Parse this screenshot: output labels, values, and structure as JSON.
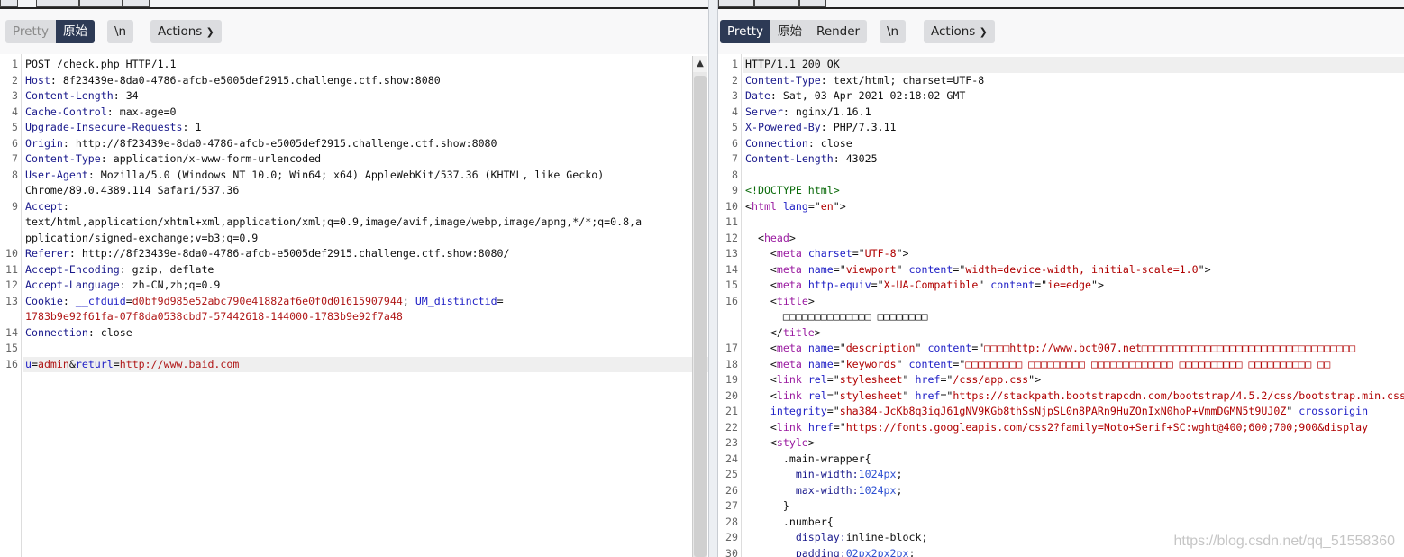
{
  "request": {
    "view_tabs": [
      "Pretty",
      "原始"
    ],
    "active_tab": "原始",
    "newline_label": "\\n",
    "actions_label": "Actions",
    "lines": [
      {
        "n": "1",
        "segs": [
          [
            "POST /check.php HTTP/1.1",
            "v"
          ]
        ]
      },
      {
        "n": "2",
        "segs": [
          [
            "Host",
            "k"
          ],
          [
            ": 8f23439e-8da0-4786-afcb-e5005def2915.challenge.ctf.show:8080",
            "v"
          ]
        ]
      },
      {
        "n": "3",
        "segs": [
          [
            "Content-Length",
            "k"
          ],
          [
            ": 34",
            "v"
          ]
        ]
      },
      {
        "n": "4",
        "segs": [
          [
            "Cache-Control",
            "k"
          ],
          [
            ": max-age=0",
            "v"
          ]
        ]
      },
      {
        "n": "5",
        "segs": [
          [
            "Upgrade-Insecure-Requests",
            "k"
          ],
          [
            ": 1",
            "v"
          ]
        ]
      },
      {
        "n": "6",
        "segs": [
          [
            "Origin",
            "k"
          ],
          [
            ": http://8f23439e-8da0-4786-afcb-e5005def2915.challenge.ctf.show:8080",
            "v"
          ]
        ]
      },
      {
        "n": "7",
        "segs": [
          [
            "Content-Type",
            "k"
          ],
          [
            ": application/x-www-form-urlencoded",
            "v"
          ]
        ]
      },
      {
        "n": "8",
        "segs": [
          [
            "User-Agent",
            "k"
          ],
          [
            ": Mozilla/5.0 (Windows NT 10.0; Win64; x64) AppleWebKit/537.36 (KHTML, like Gecko)",
            "v"
          ]
        ]
      },
      {
        "n": "",
        "segs": [
          [
            "Chrome/89.0.4389.114 Safari/537.36",
            "v"
          ]
        ]
      },
      {
        "n": "9",
        "segs": [
          [
            "Accept",
            "k"
          ],
          [
            ":",
            "v"
          ]
        ]
      },
      {
        "n": "",
        "segs": [
          [
            "text/html,application/xhtml+xml,application/xml;q=0.9,image/avif,image/webp,image/apng,*/*;q=0.8,a",
            "v"
          ]
        ]
      },
      {
        "n": "",
        "segs": [
          [
            "pplication/signed-exchange;v=b3;q=0.9",
            "v"
          ]
        ]
      },
      {
        "n": "10",
        "segs": [
          [
            "Referer",
            "k"
          ],
          [
            ": http://8f23439e-8da0-4786-afcb-e5005def2915.challenge.ctf.show:8080/",
            "v"
          ]
        ]
      },
      {
        "n": "11",
        "segs": [
          [
            "Accept-Encoding",
            "k"
          ],
          [
            ": gzip, deflate",
            "v"
          ]
        ]
      },
      {
        "n": "12",
        "segs": [
          [
            "Accept-Language",
            "k"
          ],
          [
            ": zh-CN,zh;q=0.9",
            "v"
          ]
        ]
      },
      {
        "n": "13",
        "segs": [
          [
            "Cookie",
            "k"
          ],
          [
            ": ",
            "v"
          ],
          [
            "__cfduid",
            "at"
          ],
          [
            "=",
            "v"
          ],
          [
            "d0bf9d985e52abc790e41882af6e0f0d01615907944",
            "r"
          ],
          [
            "; ",
            "v"
          ],
          [
            "UM_distinctid",
            "at"
          ],
          [
            "=",
            "v"
          ]
        ]
      },
      {
        "n": "",
        "segs": [
          [
            "1783b9e92f61fa-07f8da0538cbd7-57442618-144000-1783b9e92f7a48",
            "r"
          ]
        ]
      },
      {
        "n": "14",
        "segs": [
          [
            "Connection",
            "k"
          ],
          [
            ": close",
            "v"
          ]
        ]
      },
      {
        "n": "15",
        "segs": []
      },
      {
        "n": "16",
        "hl": true,
        "segs": [
          [
            "u",
            "at"
          ],
          [
            "=",
            "v"
          ],
          [
            "admin",
            "r"
          ],
          [
            "&",
            "v"
          ],
          [
            "returl",
            "at"
          ],
          [
            "=",
            "v"
          ],
          [
            "http://www.baid.com",
            "r"
          ]
        ]
      }
    ]
  },
  "response": {
    "view_tabs": [
      "Pretty",
      "原始",
      "Render"
    ],
    "active_tab": "Pretty",
    "newline_label": "\\n",
    "actions_label": "Actions",
    "lines": [
      {
        "n": "1",
        "hl": true,
        "segs": [
          [
            "HTTP/1.1 200 OK",
            "v"
          ]
        ]
      },
      {
        "n": "2",
        "segs": [
          [
            "Content-Type",
            "k"
          ],
          [
            ": text/html; charset=UTF-8",
            "v"
          ]
        ]
      },
      {
        "n": "3",
        "segs": [
          [
            "Date",
            "k"
          ],
          [
            ": Sat, 03 Apr 2021 02:18:02 GMT",
            "v"
          ]
        ]
      },
      {
        "n": "4",
        "segs": [
          [
            "Server",
            "k"
          ],
          [
            ": nginx/1.16.1",
            "v"
          ]
        ]
      },
      {
        "n": "5",
        "segs": [
          [
            "X-Powered-By",
            "k"
          ],
          [
            ": PHP/7.3.11",
            "v"
          ]
        ]
      },
      {
        "n": "6",
        "segs": [
          [
            "Connection",
            "k"
          ],
          [
            ": close",
            "v"
          ]
        ]
      },
      {
        "n": "7",
        "segs": [
          [
            "Content-Length",
            "k"
          ],
          [
            ": 43025",
            "v"
          ]
        ]
      },
      {
        "n": "8",
        "segs": []
      },
      {
        "n": "9",
        "segs": [
          [
            "<!DOCTYPE html>",
            "dt"
          ]
        ]
      },
      {
        "n": "10",
        "segs": [
          [
            "<",
            "p"
          ],
          [
            "html",
            "tag"
          ],
          [
            " ",
            "p"
          ],
          [
            "lang",
            "at"
          ],
          [
            "=\"",
            "p"
          ],
          [
            "en",
            "av"
          ],
          [
            "\">",
            "p"
          ]
        ]
      },
      {
        "n": "11",
        "segs": []
      },
      {
        "n": "12",
        "segs": [
          [
            "  <",
            "p"
          ],
          [
            "head",
            "tag"
          ],
          [
            ">",
            "p"
          ]
        ]
      },
      {
        "n": "13",
        "segs": [
          [
            "    <",
            "p"
          ],
          [
            "meta",
            "tag"
          ],
          [
            " ",
            "p"
          ],
          [
            "charset",
            "at"
          ],
          [
            "=\"",
            "p"
          ],
          [
            "UTF-8",
            "av"
          ],
          [
            "\">",
            "p"
          ]
        ]
      },
      {
        "n": "14",
        "segs": [
          [
            "    <",
            "p"
          ],
          [
            "meta",
            "tag"
          ],
          [
            " ",
            "p"
          ],
          [
            "name",
            "at"
          ],
          [
            "=\"",
            "p"
          ],
          [
            "viewport",
            "av"
          ],
          [
            "\" ",
            "p"
          ],
          [
            "content",
            "at"
          ],
          [
            "=\"",
            "p"
          ],
          [
            "width=device-width, initial-scale=1.0",
            "av"
          ],
          [
            "\">",
            "p"
          ]
        ]
      },
      {
        "n": "15",
        "segs": [
          [
            "    <",
            "p"
          ],
          [
            "meta",
            "tag"
          ],
          [
            " ",
            "p"
          ],
          [
            "http-equiv",
            "at"
          ],
          [
            "=\"",
            "p"
          ],
          [
            "X-UA-Compatible",
            "av"
          ],
          [
            "\" ",
            "p"
          ],
          [
            "content",
            "at"
          ],
          [
            "=\"",
            "p"
          ],
          [
            "ie=edge",
            "av"
          ],
          [
            "\">",
            "p"
          ]
        ]
      },
      {
        "n": "16",
        "segs": [
          [
            "    <",
            "p"
          ],
          [
            "title",
            "tag"
          ],
          [
            ">",
            "p"
          ]
        ]
      },
      {
        "n": "",
        "segs": [
          [
            "      □□□□□□□□□□□□□□ □□□□□□□□",
            "p"
          ]
        ]
      },
      {
        "n": "",
        "segs": [
          [
            "    </",
            "p"
          ],
          [
            "title",
            "tag"
          ],
          [
            ">",
            "p"
          ]
        ]
      },
      {
        "n": "17",
        "segs": [
          [
            "    <",
            "p"
          ],
          [
            "meta",
            "tag"
          ],
          [
            " ",
            "p"
          ],
          [
            "name",
            "at"
          ],
          [
            "=\"",
            "p"
          ],
          [
            "description",
            "av"
          ],
          [
            "\" ",
            "p"
          ],
          [
            "content",
            "at"
          ],
          [
            "=\"",
            "p"
          ],
          [
            "□□□□http://www.bct007.net□□□□□□□□□□□□□□□□□□□□□□□□□□□□□□□□□□",
            "av"
          ]
        ]
      },
      {
        "n": "18",
        "segs": [
          [
            "    <",
            "p"
          ],
          [
            "meta",
            "tag"
          ],
          [
            " ",
            "p"
          ],
          [
            "name",
            "at"
          ],
          [
            "=\"",
            "p"
          ],
          [
            "keywords",
            "av"
          ],
          [
            "\" ",
            "p"
          ],
          [
            "content",
            "at"
          ],
          [
            "=\"",
            "p"
          ],
          [
            "□□□□□□□□□ □□□□□□□□□ □□□□□□□□□□□□□ □□□□□□□□□□ □□□□□□□□□□ □□",
            "av"
          ]
        ]
      },
      {
        "n": "19",
        "segs": [
          [
            "    <",
            "p"
          ],
          [
            "link",
            "tag"
          ],
          [
            " ",
            "p"
          ],
          [
            "rel",
            "at"
          ],
          [
            "=\"",
            "p"
          ],
          [
            "stylesheet",
            "av"
          ],
          [
            "\" ",
            "p"
          ],
          [
            "href",
            "at"
          ],
          [
            "=\"",
            "p"
          ],
          [
            "/css/app.css",
            "av"
          ],
          [
            "\">",
            "p"
          ]
        ]
      },
      {
        "n": "20",
        "segs": [
          [
            "    <",
            "p"
          ],
          [
            "link",
            "tag"
          ],
          [
            " ",
            "p"
          ],
          [
            "rel",
            "at"
          ],
          [
            "=\"",
            "p"
          ],
          [
            "stylesheet",
            "av"
          ],
          [
            "\" ",
            "p"
          ],
          [
            "href",
            "at"
          ],
          [
            "=\"",
            "p"
          ],
          [
            "https://stackpath.bootstrapcdn.com/bootstrap/4.5.2/css/bootstrap.min.css",
            "av"
          ]
        ]
      },
      {
        "n": "21",
        "segs": [
          [
            "    ",
            "p"
          ],
          [
            "integrity",
            "at"
          ],
          [
            "=\"",
            "p"
          ],
          [
            "sha384-JcKb8q3iqJ61gNV9KGb8thSsNjpSL0n8PARn9HuZOnIxN0hoP+VmmDGMN5t9UJ0Z",
            "av"
          ],
          [
            "\" ",
            "p"
          ],
          [
            "crossorigin",
            "at"
          ]
        ]
      },
      {
        "n": "22",
        "segs": [
          [
            "    <",
            "p"
          ],
          [
            "link",
            "tag"
          ],
          [
            " ",
            "p"
          ],
          [
            "href",
            "at"
          ],
          [
            "=\"",
            "p"
          ],
          [
            "https://fonts.googleapis.com/css2?family=Noto+Serif+SC:wght@400;600;700;900&display",
            "av"
          ]
        ]
      },
      {
        "n": "23",
        "segs": [
          [
            "    <",
            "p"
          ],
          [
            "style",
            "tag"
          ],
          [
            ">",
            "p"
          ]
        ]
      },
      {
        "n": "24",
        "segs": [
          [
            "      .main-wrapper{",
            "p"
          ]
        ]
      },
      {
        "n": "25",
        "segs": [
          [
            "        min-width:",
            "k"
          ],
          [
            "1024px",
            "num"
          ],
          [
            ";",
            "p"
          ]
        ]
      },
      {
        "n": "26",
        "segs": [
          [
            "        max-width:",
            "k"
          ],
          [
            "1024px",
            "num"
          ],
          [
            ";",
            "p"
          ]
        ]
      },
      {
        "n": "27",
        "segs": [
          [
            "      }",
            "p"
          ]
        ]
      },
      {
        "n": "28",
        "segs": [
          [
            "      .number{",
            "p"
          ]
        ]
      },
      {
        "n": "29",
        "segs": [
          [
            "        display:",
            "k"
          ],
          [
            "inline-block;",
            "p"
          ]
        ]
      },
      {
        "n": "30",
        "segs": [
          [
            "        padding:",
            "k"
          ],
          [
            "02px2px2px",
            "num"
          ],
          [
            ";",
            "p"
          ]
        ]
      }
    ]
  },
  "watermark": "https://blog.csdn.net/qq_51558360"
}
